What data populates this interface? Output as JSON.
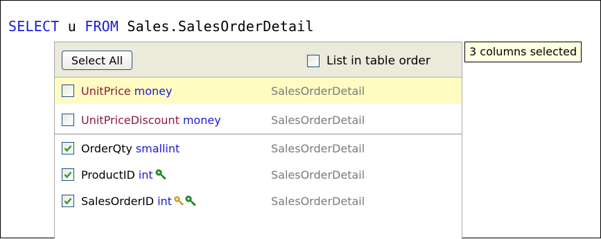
{
  "query": {
    "kw_select": "SELECT",
    "ident_u": "u",
    "kw_from": "FROM",
    "table": "Sales.SalesOrderDetail"
  },
  "popup": {
    "select_all_label": "Select All",
    "list_order_label": "List in table order",
    "list_order_checked": false
  },
  "columns_unselected": [
    {
      "name": "UnitPrice",
      "type": "money",
      "table": "SalesOrderDetail",
      "checked": false,
      "highlighted": true
    },
    {
      "name": "UnitPriceDiscount",
      "type": "money",
      "table": "SalesOrderDetail",
      "checked": false,
      "highlighted": false
    }
  ],
  "columns_selected": [
    {
      "name": "OrderQty",
      "type": "smallint",
      "table": "SalesOrderDetail",
      "checked": true,
      "keys": []
    },
    {
      "name": "ProductID",
      "type": "int",
      "table": "SalesOrderDetail",
      "checked": true,
      "keys": [
        "green-key-icon"
      ]
    },
    {
      "name": "SalesOrderID",
      "type": "int",
      "table": "SalesOrderDetail",
      "checked": true,
      "keys": [
        "gold-key-icon",
        "green-key-icon"
      ]
    }
  ],
  "tooltip": {
    "text": "3 columns selected"
  },
  "colors": {
    "keyword": "#1a1ad6",
    "type": "#1a1ad6",
    "unselected_name": "#8a1c3c",
    "table_ref": "#7a7a7a",
    "highlight_row": "#fffbc2",
    "check": "#21a121"
  }
}
